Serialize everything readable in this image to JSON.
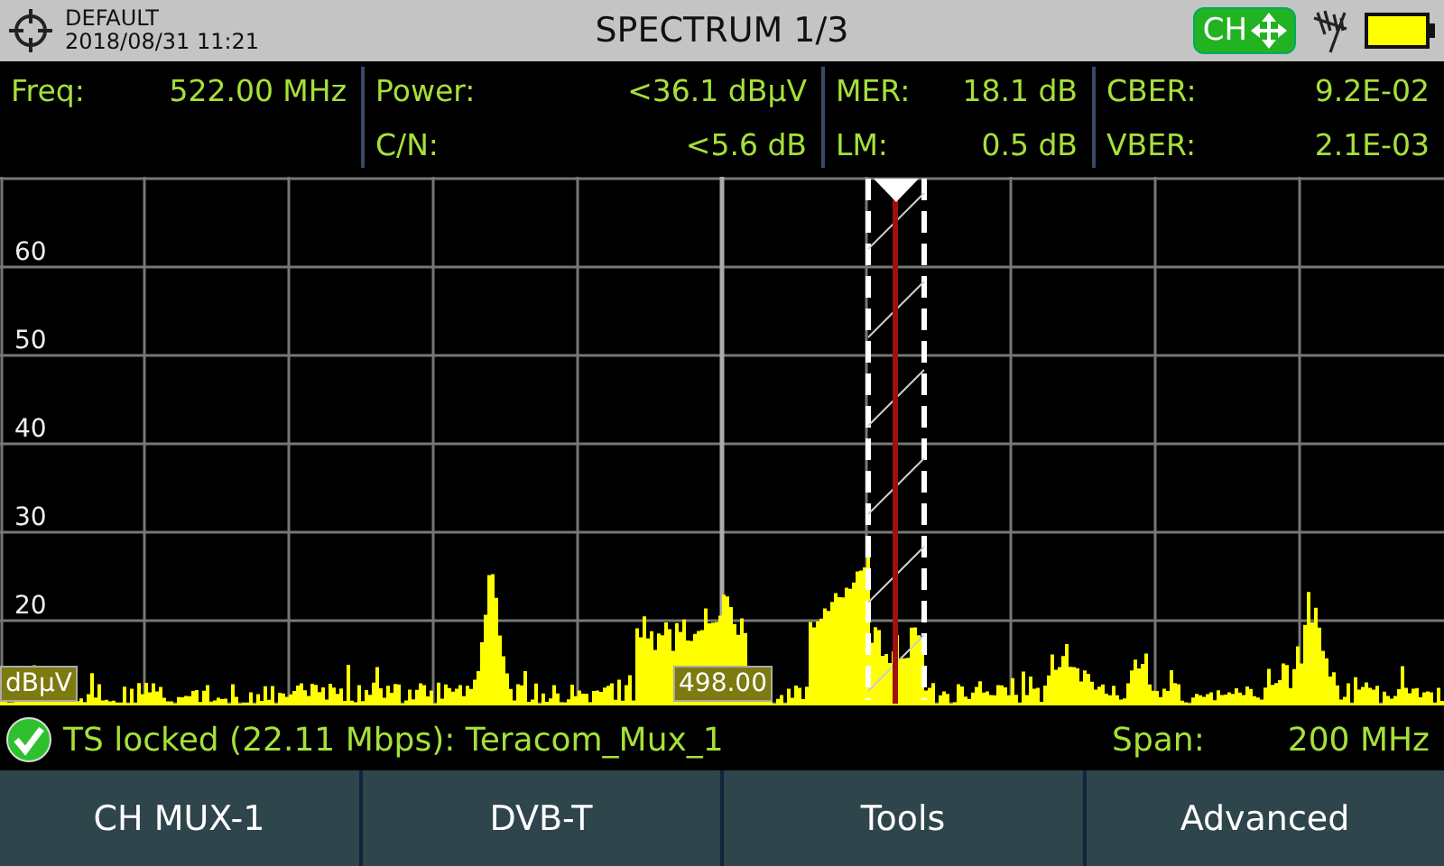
{
  "header": {
    "profile": "DEFAULT",
    "datetime": "2018/08/31 11:21",
    "title": "SPECTRUM 1/3",
    "mode_badge": "CH"
  },
  "measurements": [
    [
      {
        "label": "Freq:",
        "value": "522.00 MHz"
      }
    ],
    [
      {
        "label": "Power:",
        "value": "<36.1 dBµV"
      },
      {
        "label": "C/N:",
        "value": "<5.6 dB"
      }
    ],
    [
      {
        "label": "MER:",
        "value": "18.1 dB"
      },
      {
        "label": "LM:",
        "value": "0.5 dB"
      }
    ],
    [
      {
        "label": "CBER:",
        "value": "9.2E-02"
      },
      {
        "label": "VBER:",
        "value": "2.1E-03"
      }
    ]
  ],
  "spectrum": {
    "y_labels": [
      "60",
      "50",
      "40",
      "30",
      "20"
    ],
    "unit": "dBµV",
    "center_frequency": "498.00"
  },
  "status": {
    "text": "TS locked (22.11 Mbps): Teracom_Mux_1",
    "locked": true,
    "span_label": "Span:",
    "span_value": "200 MHz"
  },
  "softkeys": [
    "CH MUX-1",
    "DVB-T",
    "Tools",
    "Advanced"
  ]
}
